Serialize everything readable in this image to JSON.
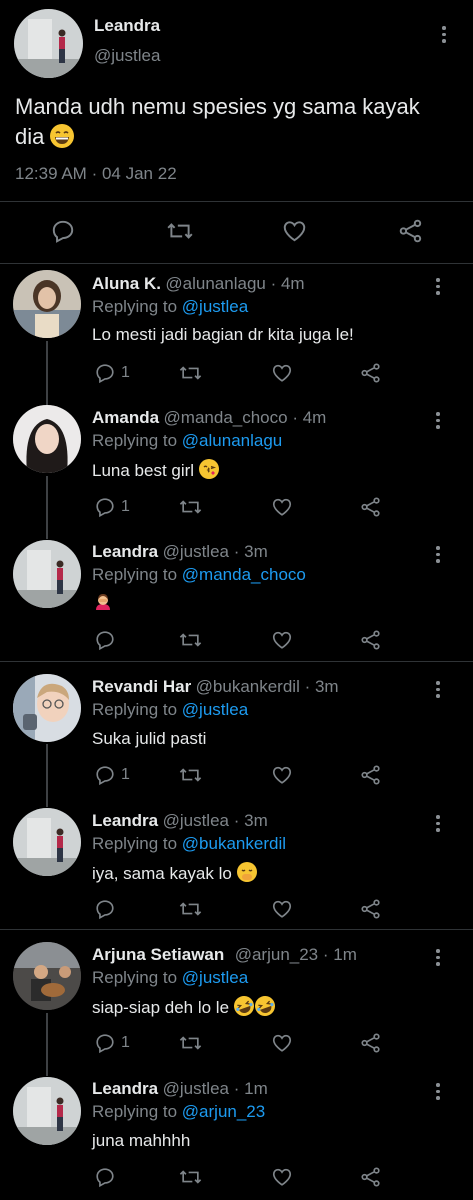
{
  "main_tweet": {
    "name": "Leandra",
    "handle": "@justlea",
    "text": "Manda udh nemu spesies yg sama kayak dia",
    "emoji": "😄",
    "time": "12:39 AM",
    "separator": "·",
    "date": "04 Jan 22"
  },
  "replies": [
    {
      "name": "Aluna K.",
      "handle": "@alunanlagu",
      "age": "4m",
      "replying_label": "Replying to",
      "replying_to": "@justlea",
      "text": "Lo mesti jadi bagian dr kita juga le!",
      "emoji": "",
      "reply_count": "1"
    },
    {
      "name": "Amanda",
      "handle": "@manda_choco",
      "age": "4m",
      "replying_label": "Replying to",
      "replying_to": "@alunanlagu",
      "text": "Luna best girl",
      "emoji": "😘",
      "reply_count": "1"
    },
    {
      "name": "Leandra",
      "handle": "@justlea",
      "age": "3m",
      "replying_label": "Replying to",
      "replying_to": "@manda_choco",
      "text": "",
      "emoji": "🤦‍♀️",
      "reply_count": ""
    },
    {
      "name": "Revandi Har",
      "handle": "@bukankerdil",
      "age": "3m",
      "replying_label": "Replying to",
      "replying_to": "@justlea",
      "text": "Suka julid pasti",
      "emoji": "",
      "reply_count": "1"
    },
    {
      "name": "Leandra",
      "handle": "@justlea",
      "age": "3m",
      "replying_label": "Replying to",
      "replying_to": "@bukankerdil",
      "text": "iya, sama kayak lo",
      "emoji": "🤭",
      "reply_count": ""
    },
    {
      "name": "Arjuna Setiawan",
      "handle": "@arjun_23",
      "age": "1m",
      "replying_label": "Replying to",
      "replying_to": "@justlea",
      "text": "siap-siap deh lo le",
      "emoji": "🤣🤣",
      "reply_count": "1"
    },
    {
      "name": "Leandra",
      "handle": "@justlea",
      "age": "1m",
      "replying_label": "Replying to",
      "replying_to": "@arjun_23",
      "text": "juna mahhhh",
      "emoji": "",
      "reply_count": ""
    }
  ],
  "colors": {
    "background": "#000000",
    "text": "#e7e9ea",
    "muted": "#7f858a",
    "link": "#1d9bf0",
    "divider": "#2f3336"
  }
}
